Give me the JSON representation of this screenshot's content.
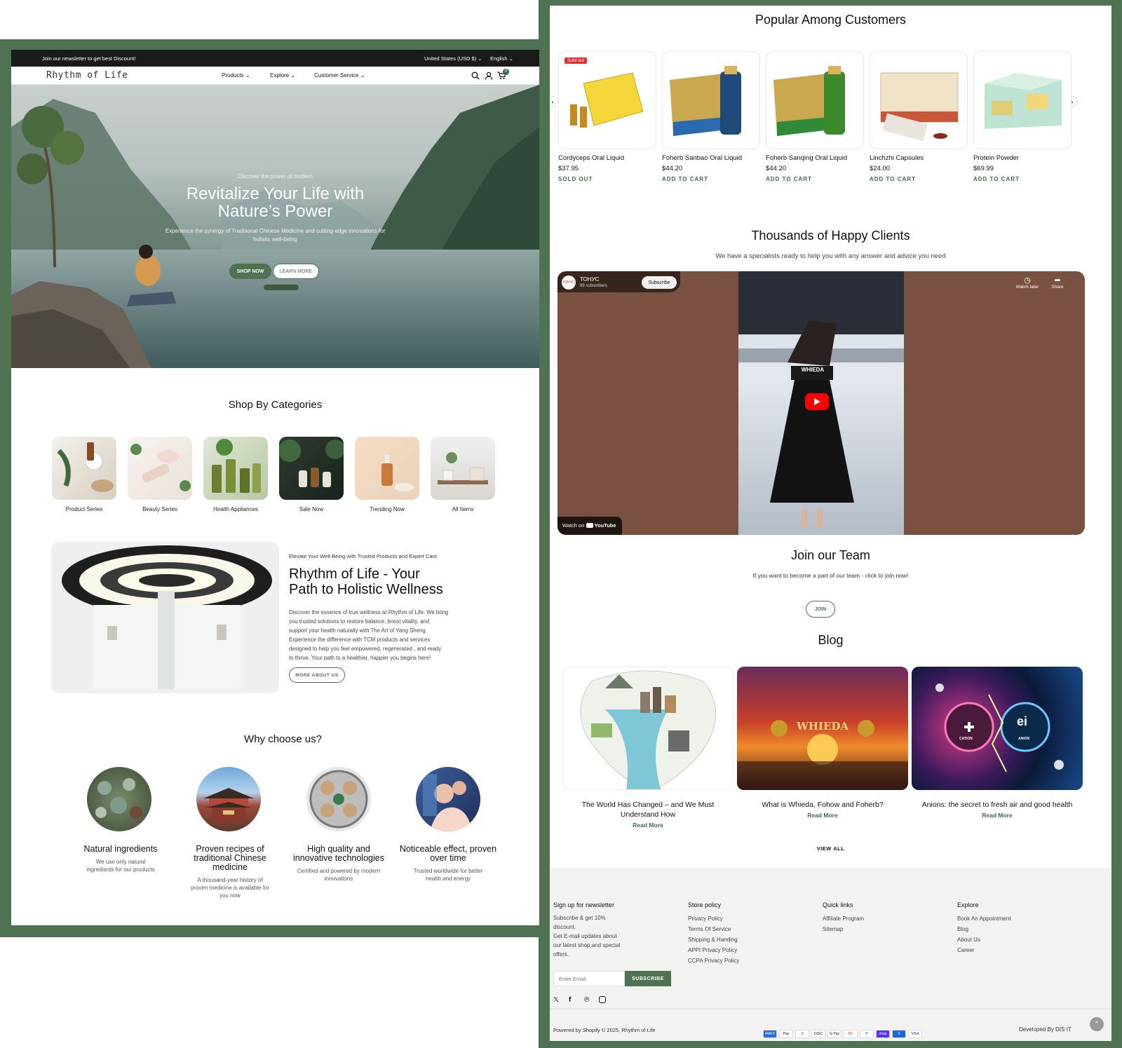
{
  "announcement": {
    "text": "Join our newsletter to get best Discount!",
    "currency": "United States (USD $)",
    "language": "English"
  },
  "header": {
    "logo": "Rhythm of Life",
    "nav": [
      "Products",
      "Explore",
      "Customer Service"
    ],
    "cart_count": "0"
  },
  "hero": {
    "eyebrow": "Discover the power of modern",
    "title_line1": "Revitalize Your Life with",
    "title_line2": "Nature’s Power",
    "subtitle_line1": "Experience the synergy of Traditional Chinese Medicine and cutting-edge innovations for",
    "subtitle_line2": "holistic well-being",
    "primary_button": "SHOP NOW",
    "secondary_button": "LEARN MORE"
  },
  "categories": {
    "title": "Shop By Categories",
    "items": [
      "Product Series",
      "Beauty Series",
      "Health Appliances",
      "Sale Now",
      "Trending Now",
      "All Items"
    ]
  },
  "about": {
    "eyebrow": "Elevate Your Well-Being with Trusted Products and Expert Care",
    "title_line1": "Rhythm of Life - Your",
    "title_line2": "Path to Holistic Wellness",
    "body_lines": [
      "Discover the essence of true wellness at Rhythm of Life. We bring",
      "you trusted solutions to restore balance, boost vitality, and",
      "support your health naturally with The Art of Yang Sheng.",
      "Experience the difference with TCM products and services",
      "designed to help you feel empowered, regenerated , and ready",
      "to thrive. Your path to a healthier, happier you begins here!"
    ],
    "button": "MORE ABOUT US"
  },
  "why": {
    "title": "Why choose us?",
    "items": [
      {
        "title": "Natural ingredients",
        "desc": "We use only natural ingredients for our products"
      },
      {
        "title": "Proven recipes of traditional Chinese medicine",
        "desc": "A thousand-year history of proven medicine is available for you now"
      },
      {
        "title": "High quality and innovative technologies",
        "desc": "Certified and powered by modern innovations"
      },
      {
        "title": "Noticeable effect, proven over time",
        "desc": "Trusted worldwide for better health and energy"
      }
    ]
  },
  "popular": {
    "title": "Popular Among Customers",
    "badge": "Sold out",
    "products": [
      {
        "name": "Cordyceps Oral Liquid",
        "price": "$37.95",
        "action": "SOLD OUT"
      },
      {
        "name": "Foherb Sanbao Oral Liquid",
        "price": "$44.20",
        "action": "ADD TO CART"
      },
      {
        "name": "Foherb Sanqing Oral Liquid",
        "price": "$44.20",
        "action": "ADD TO CART"
      },
      {
        "name": "Linchzhi Capsules",
        "price": "$24.00",
        "action": "ADD TO CART"
      },
      {
        "name": "Protein Powder",
        "price": "$69.99",
        "action": "ADD TO CART"
      }
    ]
  },
  "clients": {
    "title": "Thousands of Happy Clients",
    "subtitle": "We have a specialists ready to help you with any answer and advice you need",
    "video": {
      "channel": "ТОНУС",
      "subscribers": "89 subscribers",
      "subscribe": "Subscribe",
      "watch_later": "Watch later",
      "share": "Share",
      "watch_on": "Watch on",
      "youtube": "YouTube",
      "sign_text": "WHIEDA"
    }
  },
  "team": {
    "title": "Join our Team",
    "subtitle": "If you want to become a part of our team - click to join now!",
    "button": "JOIN"
  },
  "blog": {
    "title": "Blog",
    "posts": [
      {
        "title": "The World Has Changed – and We Must Understand How",
        "cta": "Read More"
      },
      {
        "title": "What is Whieda, Fohow and Foherb?",
        "cta": "Read More",
        "image_text": "WHIEDA"
      },
      {
        "title": "Anions: the secret to fresh air and good health",
        "cta": "Read More",
        "image_labels": [
          "CATION",
          "ANION"
        ]
      }
    ],
    "view_all": "VIEW ALL"
  },
  "footer": {
    "newsletter": {
      "title": "Sign up for newsletter",
      "lines": [
        "Subscribe & get 10%",
        "discount.",
        "Get E-mail updates about",
        "our latest shop and special",
        "offers."
      ],
      "placeholder": "Enter Email",
      "button": "SUBSCRIBE"
    },
    "store_policy": {
      "title": "Store policy",
      "links": [
        "Privacy Policy",
        "Terms Of Service",
        "Shipping & Handing",
        "APPI Privacy Policy",
        "CCPA Privacy Policy"
      ]
    },
    "quick_links": {
      "title": "Quick links",
      "links": [
        "Affiliate Program",
        "Sitemap"
      ]
    },
    "explore": {
      "title": "Explore",
      "links": [
        "Book An Appointment",
        "Blog",
        "About Us",
        "Career"
      ]
    },
    "copyright": "Powered by Shopify © 2025, Rhythm of Life",
    "developer": "Developed By DIS IT",
    "payments": [
      "AMEX",
      "Pay",
      "D",
      "DISC",
      "G Pay",
      "MC",
      "P",
      "shop",
      "V",
      "VISA"
    ]
  },
  "colors": {
    "brand_green": "#4f7352",
    "accent_green": "#3e6b47",
    "sold_out_red": "#e03131"
  }
}
